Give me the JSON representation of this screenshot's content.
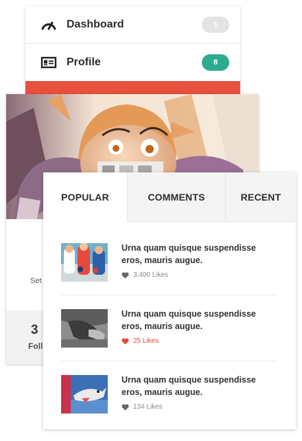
{
  "menu": {
    "items": [
      {
        "label": "Dashboard",
        "badge": "1",
        "icon": "gauge-icon"
      },
      {
        "label": "Profile",
        "badge": "8",
        "icon": "id-card-icon"
      }
    ],
    "colors": {
      "badge_gray": "#e4e4e4",
      "badge_green": "#2eab8e",
      "active_red": "#e8513d"
    }
  },
  "profile": {
    "settings_text": "Set",
    "stat_value": "3",
    "stat_label": "Foll"
  },
  "tabs": {
    "items": [
      "POPULAR",
      "COMMENTS",
      "RECENT"
    ],
    "active": "POPULAR"
  },
  "posts": [
    {
      "title": "Urna quam quisque suspendisse eros, mauris augue.",
      "likes": "3,400 Likes",
      "liked": false
    },
    {
      "title": "Urna quam quisque suspendisse eros, mauris augue.",
      "likes": "25 Likes",
      "liked": true
    },
    {
      "title": "Urna quam quisque suspendisse eros, mauris augue.",
      "likes": "134 Likes",
      "liked": false
    }
  ]
}
